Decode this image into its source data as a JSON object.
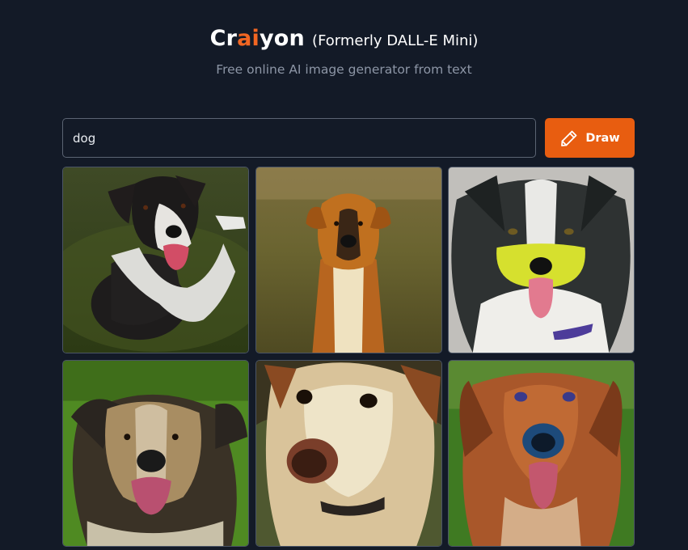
{
  "header": {
    "brand_prefix": "Cr",
    "brand_accent": "ai",
    "brand_suffix": "yon",
    "former_name": "(Formerly DALL-E Mini)",
    "subtitle": "Free online AI image generator from text"
  },
  "prompt": {
    "value": "dog"
  },
  "draw_button": {
    "label": "Draw",
    "icon": "pencil-icon",
    "color": "#e85d10"
  },
  "colors": {
    "background": "#131a27",
    "brand_accent": "#f26622"
  },
  "results": {
    "count": 6,
    "images": [
      {
        "subject": "dog-image"
      },
      {
        "subject": "dog-image"
      },
      {
        "subject": "dog-image"
      },
      {
        "subject": "dog-image"
      },
      {
        "subject": "dog-image"
      },
      {
        "subject": "dog-image"
      }
    ]
  }
}
